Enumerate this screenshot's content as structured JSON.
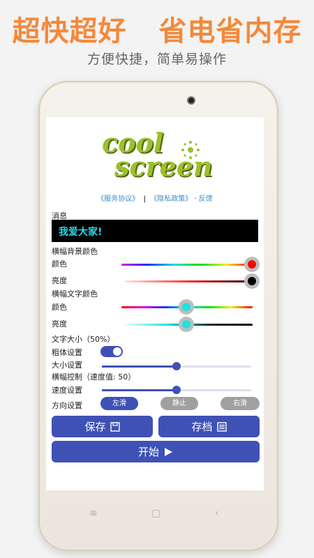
{
  "promo": {
    "headline_part1": "超快超好",
    "headline_part2": "省电省内存",
    "subheadline": "方便快捷，简单易操作"
  },
  "logo": {
    "word1": "cool",
    "word2": "screen"
  },
  "links": {
    "service_agreement": "《服务协议》",
    "separator": "|",
    "privacy_policy": "《隐私政策》",
    "dot": "·",
    "feedback": "反馈"
  },
  "message": {
    "label": "消息",
    "text": "我爱大家!"
  },
  "banner_bg_color": {
    "label": "横幅背景颜色",
    "color_label": "颜色",
    "color_value_fraction": 0.98,
    "brightness_label": "亮度",
    "brightness_value_fraction": 1.0
  },
  "banner_text_color": {
    "label": "横幅文字颜色",
    "color_label": "颜色",
    "color_value_fraction": 0.5,
    "brightness_label": "亮度",
    "brightness_value_fraction": 0.5
  },
  "text_size": {
    "label": "文字大小（50%）",
    "bold_label": "粗体设置",
    "bold_on": true,
    "size_label": "大小设置",
    "size_value_fraction": 0.5
  },
  "banner_control": {
    "label": "横幅控制（速度值: 50）",
    "speed_label": "速度设置",
    "speed_value_fraction": 0.5,
    "direction_label": "方向设置",
    "left_scroll": "左滑",
    "stop": "静止",
    "right_scroll": "右滑"
  },
  "buttons": {
    "save": "保存",
    "archive": "存档",
    "start": "开始"
  },
  "colors": {
    "promo_orange": "#f4893a",
    "primary_blue": "#3f51b5",
    "inactive_gray": "#a0a0a0",
    "banner_text": "#28d8e8"
  },
  "icons": {
    "save_icon": "floppy-icon",
    "archive_icon": "list-icon",
    "start_icon": "play-icon"
  }
}
